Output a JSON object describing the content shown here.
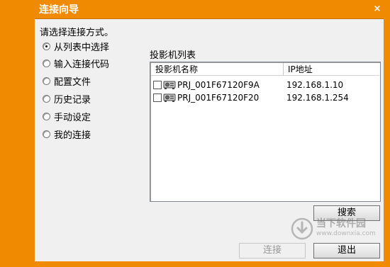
{
  "window": {
    "title": "连接向导",
    "close_symbol": "×"
  },
  "prompt": "请选择连接方式。",
  "options": [
    {
      "label": "从列表中选择",
      "checked": true
    },
    {
      "label": "输入连接代码",
      "checked": false
    },
    {
      "label": "配置文件",
      "checked": false
    },
    {
      "label": "历史记录",
      "checked": false
    },
    {
      "label": "手动设定",
      "checked": false
    },
    {
      "label": "我的连接",
      "checked": false
    }
  ],
  "projector_list": {
    "caption": "投影机列表",
    "columns": [
      "投影机名称",
      "IP地址"
    ],
    "rows": [
      {
        "name": "PRJ_001F67120F9A",
        "ip": "192.168.1.10",
        "checked": false
      },
      {
        "name": "PRJ_001F67120F20",
        "ip": "192.168.1.254",
        "checked": false
      }
    ]
  },
  "buttons": {
    "search": "搜索",
    "connect": "连接",
    "exit": "退出"
  },
  "watermark": {
    "cn": "当下软件园",
    "en": "www.downxia.com"
  },
  "colors": {
    "frame": "#f08a00",
    "client": "#f0f0f0"
  }
}
